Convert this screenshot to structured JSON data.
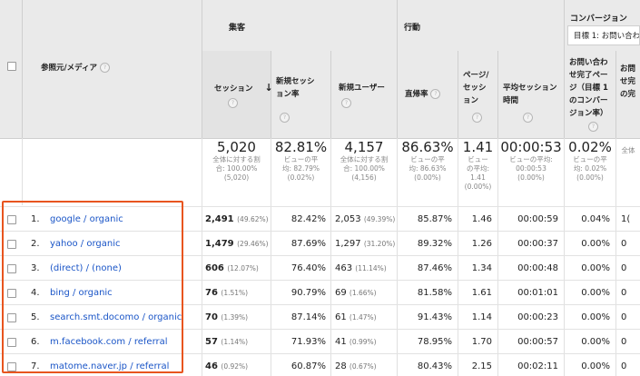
{
  "groups": {
    "acquisition": "集客",
    "behavior": "行動",
    "conversions": "コンバージョン"
  },
  "goal_select": "目標 1: お問い合わ",
  "columns": {
    "source_medium": "参照元/メディア",
    "sessions": "セッション",
    "new_session_rate": [
      "新規セッシ",
      "ョン率"
    ],
    "new_users": "新規ユーザー",
    "bounce_rate": "直帰率",
    "pages_per_session": [
      "ページ/",
      "セッシ",
      "ョン"
    ],
    "avg_session_duration": [
      "平均セッション",
      "時間"
    ],
    "goal1_rate": [
      "お問い合わ",
      "せ完了ペー",
      "ジ（目標 1",
      "のコンバー",
      "ジョン率）"
    ],
    "goal1_completions": [
      "お問",
      "せ完",
      "の完"
    ]
  },
  "sort_icon": "down-arrow",
  "help_glyph": "?",
  "totals": {
    "sessions": {
      "value": "5,020",
      "sub": [
        "全体に対する割",
        "合: 100.00%",
        "(5,020)"
      ]
    },
    "new_session_rate": {
      "value": "82.81%",
      "sub": [
        "ビューの平",
        "均: 82.79%",
        "(0.02%)"
      ]
    },
    "new_users": {
      "value": "4,157",
      "sub": [
        "全体に対する割",
        "合: 100.00%",
        "(4,156)"
      ]
    },
    "bounce_rate": {
      "value": "86.63%",
      "sub": [
        "ビューの平",
        "均: 86.63%",
        "(0.00%)"
      ]
    },
    "pages_per_session": {
      "value": "1.41",
      "sub": [
        "ビュー",
        "の平均:",
        "1.41",
        "(0.00%)"
      ]
    },
    "avg_session_duration": {
      "value": "00:00:53",
      "sub": [
        "ビューの平均:",
        "00:00:53",
        "(0.00%)"
      ]
    },
    "goal1_rate": {
      "value": "0.02%",
      "sub": [
        "ビューの平",
        "均: 0.02%",
        "(0.00%)"
      ]
    },
    "goal1_completions": {
      "value": "",
      "sub": [
        "全体"
      ]
    }
  },
  "rows": [
    {
      "idx": "1.",
      "source": "google / organic",
      "sessions": "2,491",
      "sessions_pct": "(49.62%)",
      "new_rate": "82.42%",
      "new_users": "2,053",
      "new_users_pct": "(49.39%)",
      "bounce": "85.87%",
      "pages": "1.46",
      "duration": "00:00:59",
      "goal_rate": "0.04%",
      "goal_comp": "1("
    },
    {
      "idx": "2.",
      "source": "yahoo / organic",
      "sessions": "1,479",
      "sessions_pct": "(29.46%)",
      "new_rate": "87.69%",
      "new_users": "1,297",
      "new_users_pct": "(31.20%)",
      "bounce": "89.32%",
      "pages": "1.26",
      "duration": "00:00:37",
      "goal_rate": "0.00%",
      "goal_comp": "0"
    },
    {
      "idx": "3.",
      "source": "(direct) / (none)",
      "sessions": "606",
      "sessions_pct": "(12.07%)",
      "new_rate": "76.40%",
      "new_users": "463",
      "new_users_pct": "(11.14%)",
      "bounce": "87.46%",
      "pages": "1.34",
      "duration": "00:00:48",
      "goal_rate": "0.00%",
      "goal_comp": "0"
    },
    {
      "idx": "4.",
      "source": "bing / organic",
      "sessions": "76",
      "sessions_pct": "(1.51%)",
      "new_rate": "90.79%",
      "new_users": "69",
      "new_users_pct": "(1.66%)",
      "bounce": "81.58%",
      "pages": "1.61",
      "duration": "00:01:01",
      "goal_rate": "0.00%",
      "goal_comp": "0"
    },
    {
      "idx": "5.",
      "source": "search.smt.docomo / organic",
      "sessions": "70",
      "sessions_pct": "(1.39%)",
      "new_rate": "87.14%",
      "new_users": "61",
      "new_users_pct": "(1.47%)",
      "bounce": "91.43%",
      "pages": "1.14",
      "duration": "00:00:23",
      "goal_rate": "0.00%",
      "goal_comp": "0"
    },
    {
      "idx": "6.",
      "source": "m.facebook.com / referral",
      "sessions": "57",
      "sessions_pct": "(1.14%)",
      "new_rate": "71.93%",
      "new_users": "41",
      "new_users_pct": "(0.99%)",
      "bounce": "78.95%",
      "pages": "1.70",
      "duration": "00:00:57",
      "goal_rate": "0.00%",
      "goal_comp": "0"
    },
    {
      "idx": "7.",
      "source": "matome.naver.jp / referral",
      "sessions": "46",
      "sessions_pct": "(0.92%)",
      "new_rate": "60.87%",
      "new_users": "28",
      "new_users_pct": "(0.67%)",
      "bounce": "80.43%",
      "pages": "2.15",
      "duration": "00:02:11",
      "goal_rate": "0.00%",
      "goal_comp": "0"
    }
  ],
  "colors": {
    "header_bg": "#eaeaea",
    "link": "#1a55c7",
    "highlight": "#e8551f"
  }
}
